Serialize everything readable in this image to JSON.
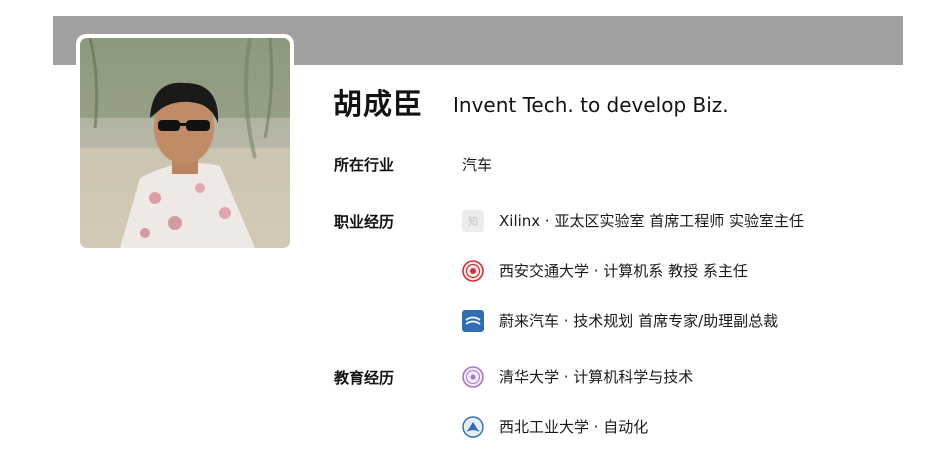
{
  "profile": {
    "name": "胡成臣",
    "headline": "Invent Tech. to develop Biz."
  },
  "industry": {
    "label": "所在行业",
    "value": "汽车"
  },
  "career": {
    "label": "职业经历",
    "items": [
      {
        "text": "Xilinx · 亚太区实验室 首席工程师 实验室主任",
        "logo": "zhihu-placeholder-logo",
        "logo_text": "知"
      },
      {
        "text": "西安交通大学 · 计算机系 教授 系主任",
        "logo": "xjtu-emblem-logo"
      },
      {
        "text": "蔚来汽车 · 技术规划 首席专家/助理副总裁",
        "logo": "nio-logo"
      }
    ]
  },
  "education": {
    "label": "教育经历",
    "items": [
      {
        "text": "清华大学 · 计算机科学与技术",
        "logo": "tsinghua-emblem-logo"
      },
      {
        "text": "西北工业大学 · 自动化",
        "logo": "nwpu-emblem-logo"
      }
    ]
  },
  "colors": {
    "cover": "#a0a0a0",
    "text": "#121212",
    "xjtu_red": "#c8363a",
    "nio_blue": "#2f6db5",
    "tsinghua_purple": "#a776c8",
    "nwpu_blue": "#2f6bb0"
  }
}
